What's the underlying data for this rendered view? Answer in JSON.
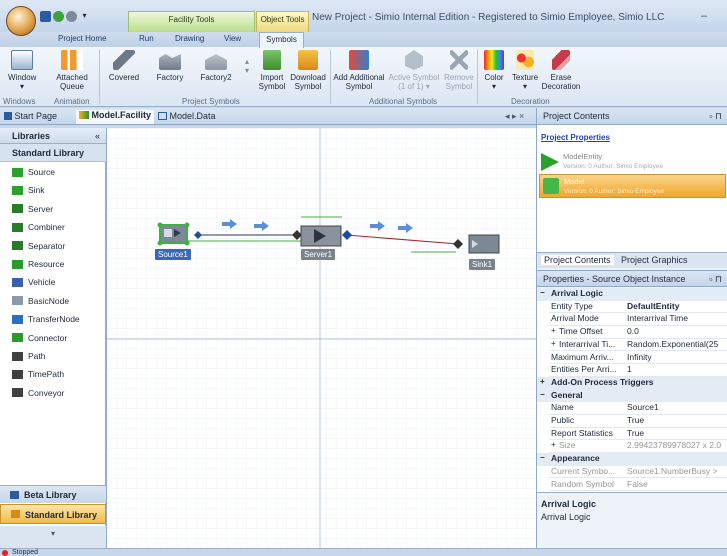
{
  "window": {
    "title": "New Project - Simio Internal Edition - Registered to Simio Employee, Simio LLC",
    "minimize_glyph": "–",
    "context_tab_facility": "Facility Tools",
    "context_tab_object": "Object Tools"
  },
  "ribbon": {
    "tabs": [
      "Project Home",
      "Run",
      "Drawing",
      "View",
      "Symbols"
    ],
    "active_tab": "Symbols",
    "buttons": {
      "window": "Window",
      "attached_queue": "Attached Queue",
      "covered": "Covered",
      "factory": "Factory",
      "factory2": "Factory2",
      "import_symbol": "Import Symbol",
      "download_symbol": "Download Symbol",
      "add_additional_symbol": "Add Additional Symbol",
      "active_symbol": "Active Symbol",
      "active_symbol_count": "(1 of 1)",
      "remove_symbol": "Remove Symbol",
      "color": "Color",
      "texture": "Texture",
      "erase_decoration": "Erase Decoration"
    },
    "groups": {
      "windows": "Windows",
      "animation": "Animation",
      "project_symbols": "Project Symbols",
      "additional_symbols": "Additional Symbols",
      "decoration": "Decoration"
    }
  },
  "doc_tabs": {
    "start_page": "Start Page",
    "model_facility": "Model.Facility",
    "model_data": "Model.Data",
    "nav": "◂ ▸ ×"
  },
  "libraries": {
    "header": "Libraries",
    "collapse": "«",
    "standard_header": "Standard Library",
    "items": [
      "Source",
      "Sink",
      "Server",
      "Combiner",
      "Separator",
      "Resource",
      "Vehicle",
      "BasicNode",
      "TransferNode",
      "Connector",
      "Path",
      "TimePath",
      "Conveyor"
    ],
    "beta": "Beta Library",
    "standard": "Standard Library"
  },
  "facility": {
    "objects": {
      "source": "Source1",
      "server": "Server1",
      "sink": "Sink1"
    }
  },
  "project_contents": {
    "header": "Project Contents",
    "pin": "▫ ⊓",
    "properties_link": "Project Properties",
    "items": [
      {
        "name": "ModelEntity",
        "meta": "Version: 0 Author: Simio Employee"
      },
      {
        "name": "Model",
        "meta": "Version: 0 Author: Simio Employee"
      }
    ],
    "tabs": [
      "Project Contents",
      "Project Graphics"
    ]
  },
  "properties": {
    "header": "Properties - Source Object Instance",
    "rows": [
      {
        "type": "cat",
        "name": "Arrival Logic",
        "sign": "−"
      },
      {
        "type": "row",
        "name": "Entity Type",
        "value": "DefaultEntity",
        "bold": true
      },
      {
        "type": "row",
        "name": "Arrival Mode",
        "value": "Interarrival Time"
      },
      {
        "type": "row",
        "name": "Time Offset",
        "value": "0.0",
        "sign": "+"
      },
      {
        "type": "row",
        "name": "Interarrival Ti...",
        "value": "Random.Exponential(25",
        "sign": "+"
      },
      {
        "type": "row",
        "name": "Maximum Arriv...",
        "value": "Infinity"
      },
      {
        "type": "row",
        "name": "Entities Per Arri...",
        "value": "1"
      },
      {
        "type": "cat",
        "name": "Add-On Process Triggers",
        "sign": "+"
      },
      {
        "type": "cat",
        "name": "General",
        "sign": "−"
      },
      {
        "type": "row",
        "name": "Name",
        "value": "Source1"
      },
      {
        "type": "row",
        "name": "Public",
        "value": "True"
      },
      {
        "type": "row",
        "name": "Report Statistics",
        "value": "True"
      },
      {
        "type": "row",
        "name": "Size",
        "value": "2.99423789978027 x 2.0",
        "sign": "+",
        "dim": true
      },
      {
        "type": "cat",
        "name": "Appearance",
        "sign": "−"
      },
      {
        "type": "row",
        "name": "Current Symbo...",
        "value": "Source1.NumberBusy >",
        "dim": true
      },
      {
        "type": "row",
        "name": "Random Symbol",
        "value": "False",
        "dim": true
      }
    ],
    "description_title": "Arrival Logic",
    "description_text": "Arrival Logic"
  },
  "status": {
    "text": "Stopped"
  }
}
